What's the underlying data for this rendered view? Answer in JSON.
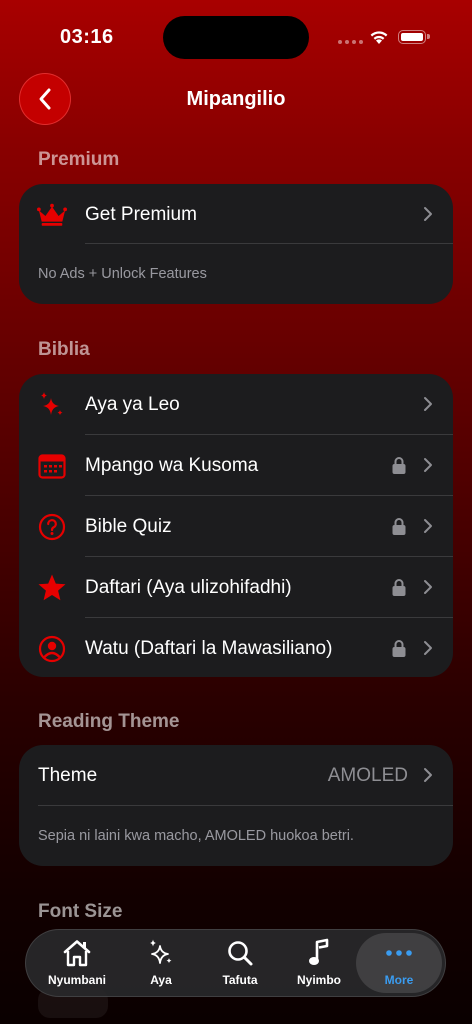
{
  "status_bar": {
    "time": "03:16"
  },
  "nav": {
    "title": "Mipangilio"
  },
  "premium": {
    "header": "Premium",
    "row_label": "Get Premium",
    "footer": "No Ads + Unlock Features"
  },
  "biblia": {
    "header": "Biblia",
    "items": [
      {
        "label": "Aya ya Leo",
        "icon": "sparkles-icon",
        "locked": false
      },
      {
        "label": "Mpango wa Kusoma",
        "icon": "calendar-icon",
        "locked": true
      },
      {
        "label": "Bible Quiz",
        "icon": "question-circle-icon",
        "locked": true
      },
      {
        "label": "Daftari (Aya ulizohifadhi)",
        "icon": "star-icon",
        "locked": true
      },
      {
        "label": "Watu (Daftari la Mawasiliano)",
        "icon": "person-circle-icon",
        "locked": true
      }
    ]
  },
  "reading_theme": {
    "header": "Reading Theme",
    "row_label": "Theme",
    "value": "AMOLED",
    "footer": "Sepia ni laini kwa macho, AMOLED huokoa betri."
  },
  "font_size": {
    "header": "Font Size"
  },
  "tab_bar": {
    "tabs": [
      {
        "label": "Nyumbani",
        "icon": "house-icon"
      },
      {
        "label": "Aya",
        "icon": "sparkles-icon"
      },
      {
        "label": "Tafuta",
        "icon": "search-icon"
      },
      {
        "label": "Nyimbo",
        "icon": "music-note-icon"
      },
      {
        "label": "More",
        "icon": "more-dots-icon",
        "active": true
      }
    ]
  },
  "colors": {
    "accent": "#e00000",
    "active_tab": "#3a9cf0",
    "card": "#1c1c1e"
  }
}
